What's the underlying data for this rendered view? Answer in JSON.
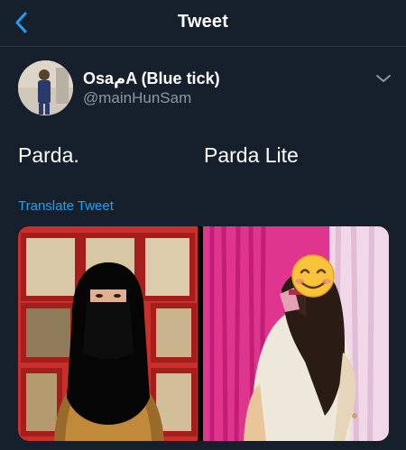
{
  "header": {
    "title": "Tweet"
  },
  "tweet": {
    "display_name": "OsaمA (Blue tick)",
    "handle": "@mainHunSam",
    "text_left": "Parda.",
    "text_right": "Parda Lite",
    "translate_label": "Translate Tweet"
  },
  "colors": {
    "background": "#16202c",
    "accent": "#1da1f2",
    "secondary_text": "#8899a6"
  },
  "icons": {
    "back": "chevron-left-icon",
    "menu": "chevron-down-icon",
    "emoji": "smiling-face-emoji"
  }
}
